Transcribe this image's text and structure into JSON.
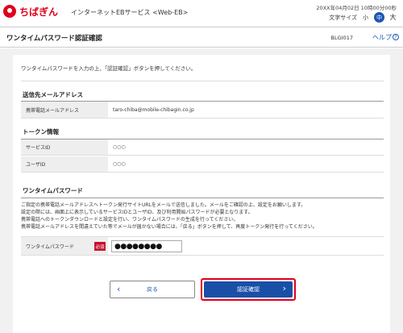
{
  "header": {
    "logo_text": "ちばぎん",
    "service_name": "インターネットEBサービス <Web-EB>",
    "datetime": "20XX年04月02日 10時00分00秒",
    "font_size_label": "文字サイズ",
    "font_small": "小",
    "font_mid": "中",
    "font_large": "大"
  },
  "titlebar": {
    "title": "ワンタイムパスワード認証確認",
    "screen_id": "BLGI017",
    "help": "ヘルプ",
    "help_icon": "?"
  },
  "intro": "ワンタイムパスワードを入力の上、「認証確認」ボタンを押してください。",
  "sections": {
    "email": {
      "title": "送信先メールアドレス",
      "label": "携帯電話メールアドレス",
      "value": "taro-chiba@mobile-chibagin.co.jp"
    },
    "token": {
      "title": "トークン情報",
      "service_id_label": "サービスID",
      "service_id_value": "○○○",
      "user_id_label": "ユーザID",
      "user_id_value": "○○○"
    },
    "otp": {
      "title": "ワンタイムパスワード",
      "notice": [
        "ご指定の携帯電話メールアドレスへトークン発行サイトURLをメールで送信しました。メールをご確認の上、設定をお願いします。",
        "設定の際には、画面上に表示しているサービスIDとユーザID、及び利用開始パスワードが必要となります。",
        "携帯電話へのトークンダウンロードと設定を行い、ワンタイムパスワードの生成を行ってください。",
        "携帯電話メールアドレスを間違えていた等でメールが届かない場合には、「戻る」ボタンを押して、再度トークン発行を行ってください。"
      ],
      "label": "ワンタイムパスワード",
      "required": "必須",
      "value": "●●●●●●●●"
    }
  },
  "buttons": {
    "back": "戻る",
    "back_icon": "‹",
    "confirm": "認証確認",
    "confirm_icon": "›"
  },
  "colors": {
    "brand_red": "#e0001b",
    "primary_blue": "#1a4fa8",
    "required_red": "#c8102e"
  }
}
